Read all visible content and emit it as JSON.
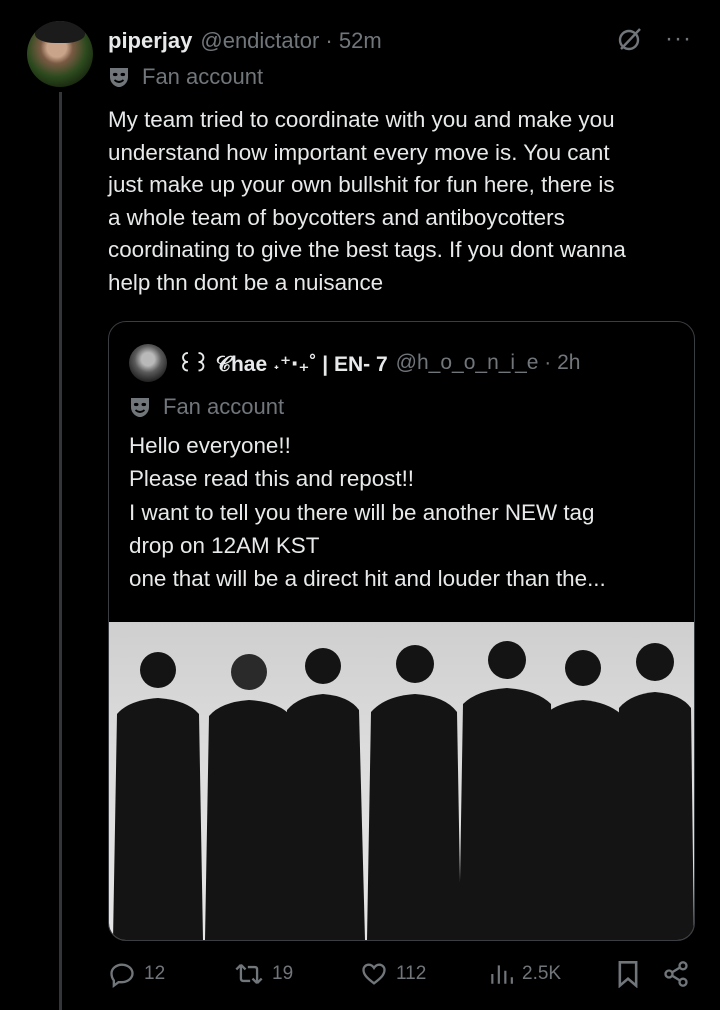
{
  "post": {
    "display_name": "piperjay",
    "handle_time": "@endictator · 52m",
    "account_label": "Fan account",
    "text": [
      "My team tried to coordinate with you and make you",
      "understand how important every move is. You cant",
      "just make up your own bullshit for fun here, there is",
      "a whole team of boycotters and antiboycotters",
      "coordinating to give the best tags. If you dont wanna",
      "help thn dont be a nuisance"
    ]
  },
  "quote": {
    "display_name": "꒰꒱ 𝒞hae ˖⁺‧₊˚ | EN- 7",
    "handle_time": "@h_o_o_n_i_e · 2h",
    "account_label": "Fan account",
    "text": [
      "Hello everyone!!",
      "Please read this and repost!!",
      "I want to tell you there will be another NEW tag",
      "drop on 12AM KST",
      "one that will be a direct hit and louder than the..."
    ]
  },
  "actions": {
    "replies": "12",
    "reposts": "19",
    "likes": "112",
    "views": "2.5K"
  },
  "icons": [
    "grok-icon",
    "more-icon",
    "mask-icon",
    "reply-icon",
    "repost-icon",
    "like-icon",
    "views-icon",
    "bookmark-icon",
    "share-icon"
  ]
}
